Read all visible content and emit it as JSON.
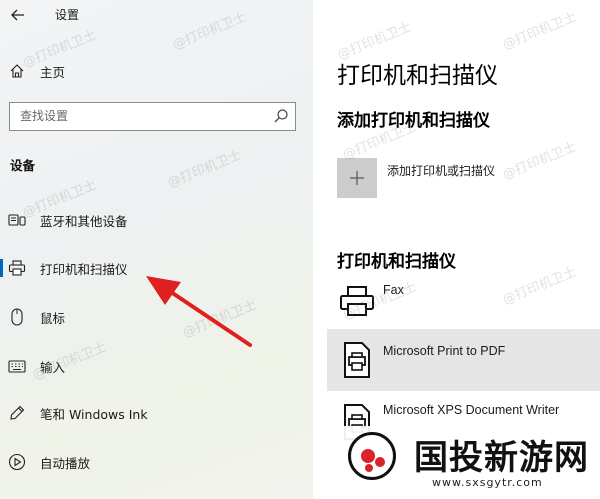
{
  "window": {
    "title": "设置"
  },
  "nav": {
    "home_label": "主页",
    "search_placeholder": "查找设置",
    "section_label": "设备",
    "items": [
      {
        "label": "蓝牙和其他设备",
        "icon": "bluetooth-devices-icon"
      },
      {
        "label": "打印机和扫描仪",
        "icon": "printer-icon"
      },
      {
        "label": "鼠标",
        "icon": "mouse-icon"
      },
      {
        "label": "输入",
        "icon": "keyboard-icon"
      },
      {
        "label": "笔和 Windows Ink",
        "icon": "pen-icon"
      },
      {
        "label": "自动播放",
        "icon": "autoplay-icon"
      }
    ],
    "selected_item": "打印机和扫描仪"
  },
  "content": {
    "page_title": "打印机和扫描仪",
    "add_section_title": "添加打印机和扫描仪",
    "add_button_label": "添加打印机或扫描仪",
    "list_title": "打印机和扫描仪",
    "printers": [
      {
        "name": "Fax",
        "icon": "fax-icon"
      },
      {
        "name": "Microsoft Print to PDF",
        "icon": "printer-document-icon"
      },
      {
        "name": "Microsoft XPS Document Writer",
        "icon": "printer-document-icon"
      }
    ],
    "selected_printer": "Microsoft Print to PDF"
  },
  "watermark": {
    "text": "@打印机卫士"
  },
  "logo": {
    "name": "国投新游网",
    "url": "www.sxsgytr.com"
  },
  "colors": {
    "accent": "#0067c0",
    "arrow": "#e02020",
    "nav_bg": "#f0f3f2",
    "selected_row": "#e5e5e5",
    "add_tile": "#cccccc"
  }
}
